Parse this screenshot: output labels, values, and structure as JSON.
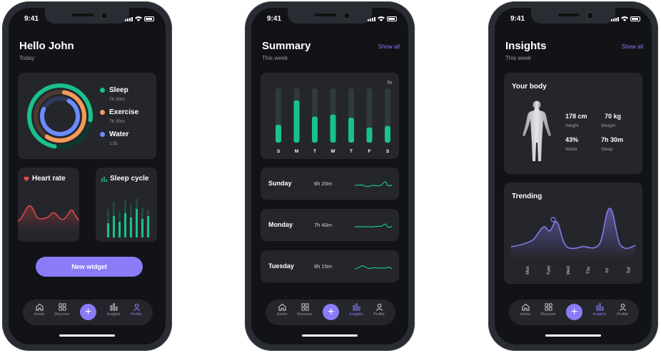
{
  "status": {
    "time": "9:41"
  },
  "colors": {
    "accent": "#8a7cf6",
    "green": "#19c18c",
    "orange": "#f39a5b",
    "blue": "#6b8cff",
    "red": "#e44848"
  },
  "tabs": [
    {
      "label": "Home",
      "icon": "home-icon"
    },
    {
      "label": "Discover",
      "icon": "discover-icon"
    },
    {
      "label": "Insights",
      "icon": "insights-icon"
    },
    {
      "label": "Profile",
      "icon": "profile-icon"
    }
  ],
  "home": {
    "title": "Hello John",
    "subtitle": "Today",
    "legend": [
      {
        "label": "Sleep",
        "value": "7h 30m"
      },
      {
        "label": "Exercise",
        "value": "7h 30m"
      },
      {
        "label": "Water",
        "value": "1.5L"
      }
    ],
    "heart_rate_title": "Heart rate",
    "sleep_cycle_title": "Sleep cycle",
    "new_widget": "New widget",
    "active_tab": "Profile"
  },
  "summary": {
    "title": "Summary",
    "subtitle": "This week",
    "show_all": "Show all",
    "chart_corner_label": "7h",
    "days_axis": [
      "S",
      "M",
      "T",
      "W",
      "T",
      "F",
      "S"
    ],
    "bar_values": [
      0.33,
      0.78,
      0.48,
      0.52,
      0.46,
      0.28,
      0.31
    ],
    "rows": [
      {
        "day": "Sunday",
        "time": "6h 20m"
      },
      {
        "day": "Monday",
        "time": "7h 40m"
      },
      {
        "day": "Tuesday",
        "time": "6h 15m"
      }
    ],
    "active_tab": "Insights"
  },
  "insights": {
    "title": "Insights",
    "subtitle": "This week",
    "show_all": "Show all",
    "body_title": "Your body",
    "stats": [
      {
        "value": "178 cm",
        "label": "Height"
      },
      {
        "value": "70 kg",
        "label": "Weight"
      },
      {
        "value": "43%",
        "label": "Water"
      },
      {
        "value": "7h 30m",
        "label": "Sleep"
      }
    ],
    "trending_title": "Trending",
    "trending_days": [
      "Mon",
      "Tues",
      "Wed",
      "Thu",
      "Fri",
      "Sat"
    ],
    "active_tab": "Insights"
  }
}
